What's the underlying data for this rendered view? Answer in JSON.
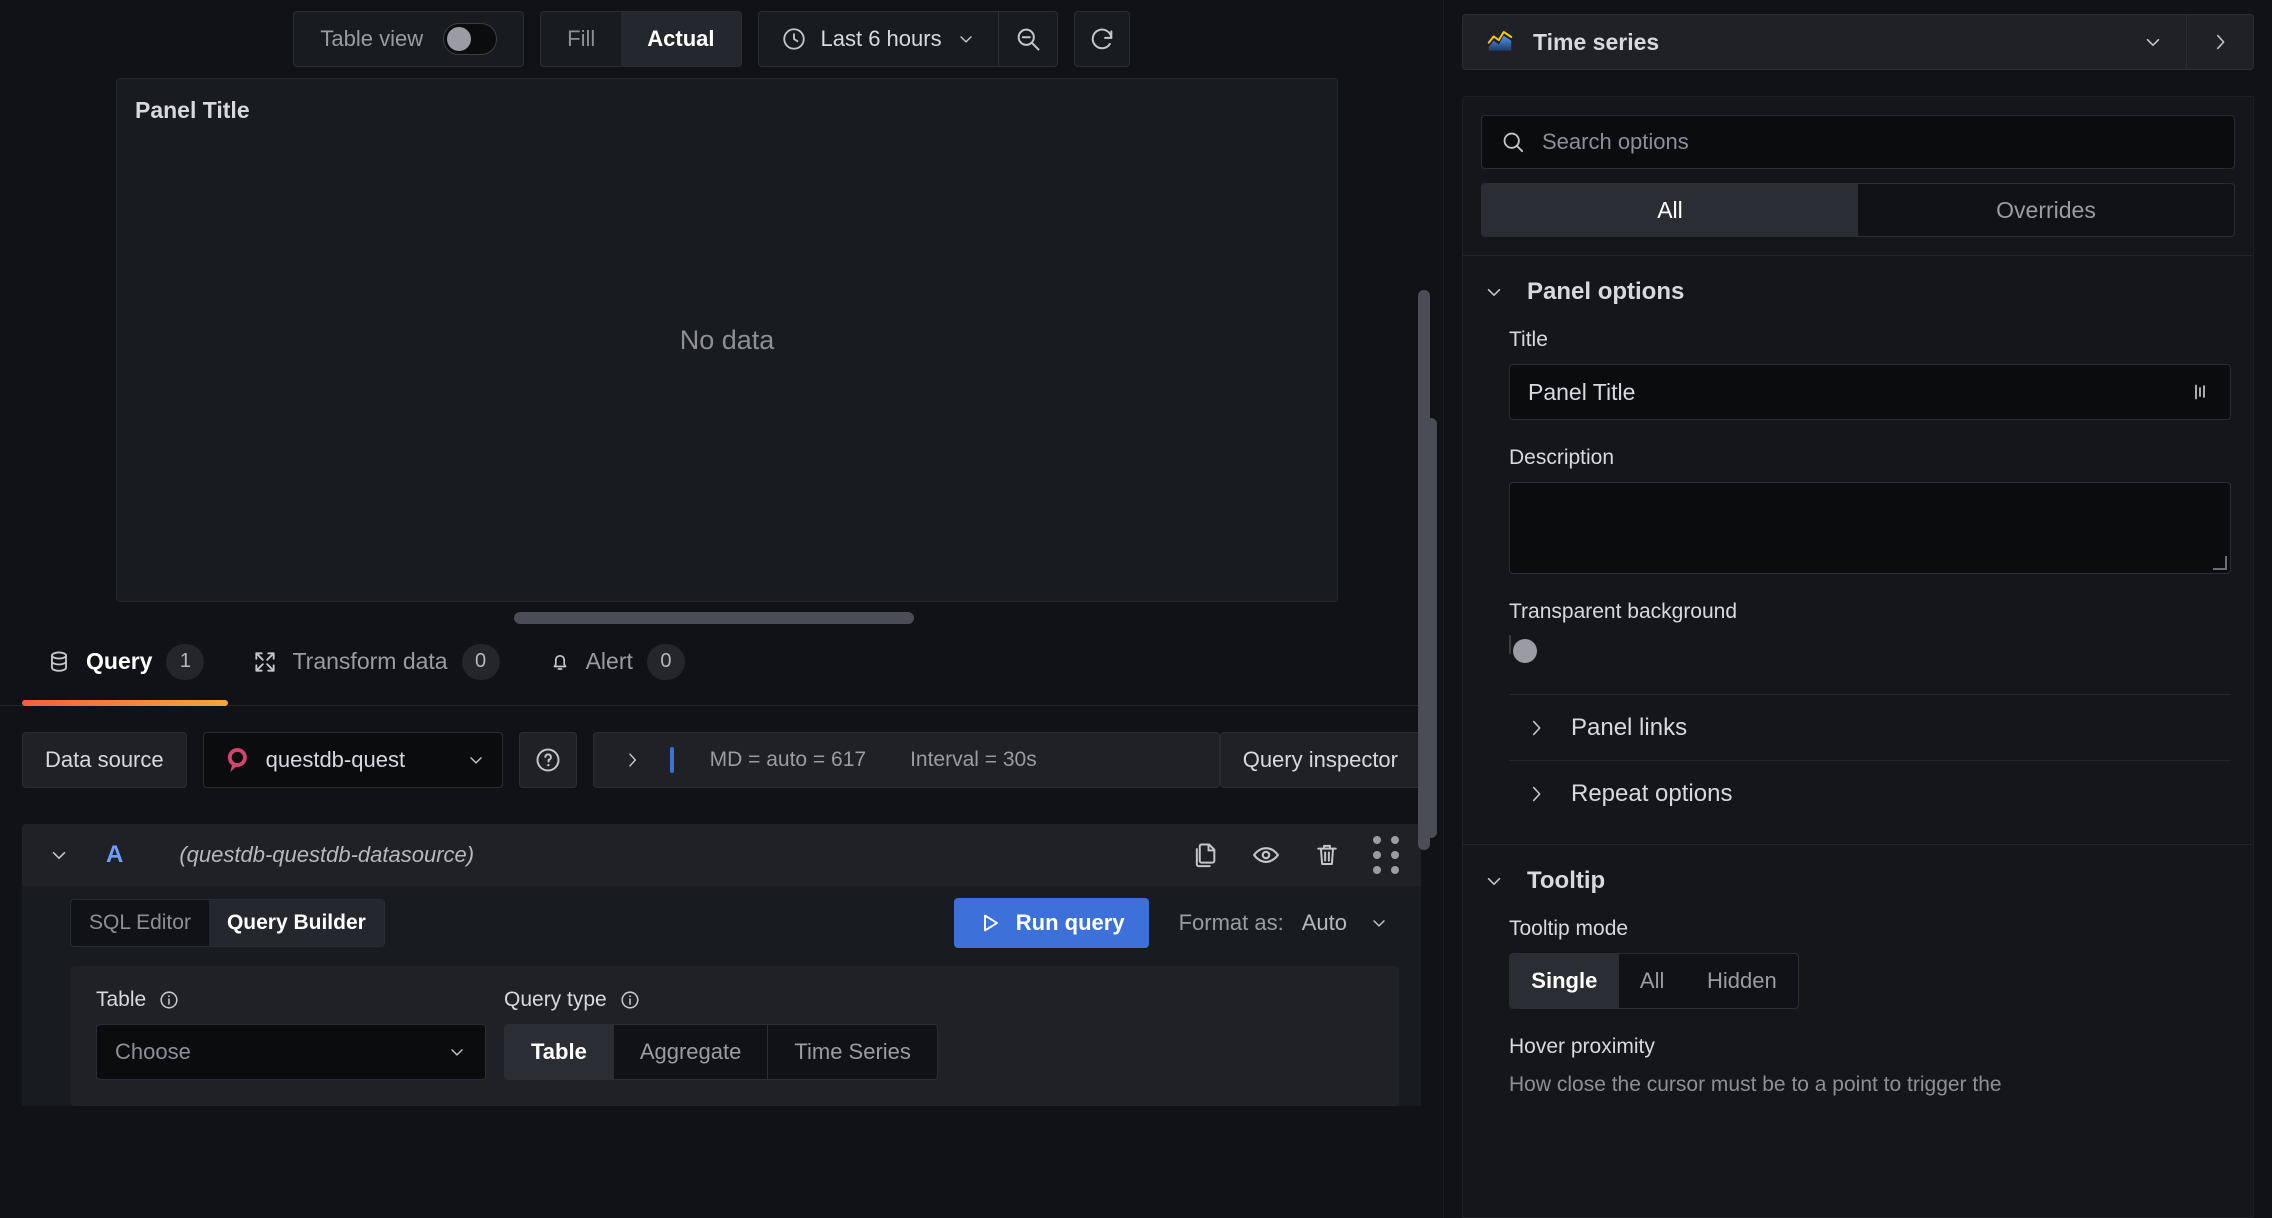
{
  "toolbar": {
    "table_view_label": "Table view",
    "table_view_on": false,
    "fill_label": "Fill",
    "actual_label": "Actual",
    "size_selected": "Actual",
    "time_range": "Last 6 hours",
    "clock_icon": "clock-icon",
    "zoom_out_icon": "zoom-out-icon",
    "refresh_icon": "refresh-icon"
  },
  "panel_preview": {
    "title": "Panel Title",
    "no_data": "No data"
  },
  "query_tabs": [
    {
      "label": "Query",
      "count": "1",
      "icon": "database-icon",
      "active": true
    },
    {
      "label": "Transform data",
      "count": "0",
      "icon": "transform-icon",
      "active": false
    },
    {
      "label": "Alert",
      "count": "0",
      "icon": "bell-icon",
      "active": false
    }
  ],
  "datasource_row": {
    "label": "Data source",
    "selected": "questdb-quest",
    "logo_icon": "questdb-logo-icon",
    "help_icon": "help-circle-icon",
    "expand_icon": "chevron-right-icon",
    "max_data_points": "MD = auto = 617",
    "interval": "Interval = 30s",
    "query_inspector": "Query inspector"
  },
  "query_row": {
    "ref_id": "A",
    "datasource_name": "(questdb-questdb-datasource)",
    "collapse_icon": "chevron-down-icon",
    "actions": [
      {
        "name": "duplicate-query-icon"
      },
      {
        "name": "hide-response-icon"
      },
      {
        "name": "remove-query-icon"
      },
      {
        "name": "drag-handle-icon"
      }
    ]
  },
  "query_editor": {
    "modes": [
      {
        "label": "SQL Editor",
        "active": false
      },
      {
        "label": "Query Builder",
        "active": true
      }
    ],
    "run_query": "Run query",
    "run_icon": "play-icon",
    "format_as_label": "Format as:",
    "format_as_value": "Auto"
  },
  "builder": {
    "table_label": "Table",
    "table_info_icon": "info-circle-icon",
    "table_placeholder": "Choose",
    "query_type_label": "Query type",
    "query_type_info_icon": "info-circle-icon",
    "query_types": [
      {
        "label": "Table",
        "active": true
      },
      {
        "label": "Aggregate",
        "active": false
      },
      {
        "label": "Time Series",
        "active": false
      }
    ]
  },
  "options_pane": {
    "viz_name": "Time series",
    "viz_icon": "timeseries-viz-icon",
    "viz_caret_icon": "chevron-down-icon",
    "viz_toggle_icon": "chevron-right-icon",
    "search_placeholder": "Search options",
    "search_icon": "search-icon",
    "search_value": "",
    "filter_tabs": [
      {
        "label": "All",
        "active": true
      },
      {
        "label": "Overrides",
        "active": false
      }
    ],
    "panel_options": {
      "section_title": "Panel options",
      "collapse_icon": "chevron-down-icon",
      "title_label": "Title",
      "title_value": "Panel Title",
      "title_suffix_icon": "dashboard-variables-icon",
      "description_label": "Description",
      "description_value": "",
      "transparent_label": "Transparent background",
      "transparent_on": false,
      "panel_links_label": "Panel links",
      "repeat_options_label": "Repeat options",
      "expand_icon": "chevron-right-icon"
    },
    "tooltip": {
      "section_title": "Tooltip",
      "collapse_icon": "chevron-down-icon",
      "mode_label": "Tooltip mode",
      "modes": [
        {
          "label": "Single",
          "active": true
        },
        {
          "label": "All",
          "active": false
        },
        {
          "label": "Hidden",
          "active": false
        }
      ],
      "hover_label": "Hover proximity",
      "hover_desc": "How close the cursor must be to a point to trigger the"
    }
  },
  "colors": {
    "accent_blue": "#3d71d9",
    "tab_underline_start": "#f55f3e",
    "tab_underline_end": "#f2a73b",
    "refid_blue": "#6e9fff",
    "questdb_pink": "#d14671"
  }
}
